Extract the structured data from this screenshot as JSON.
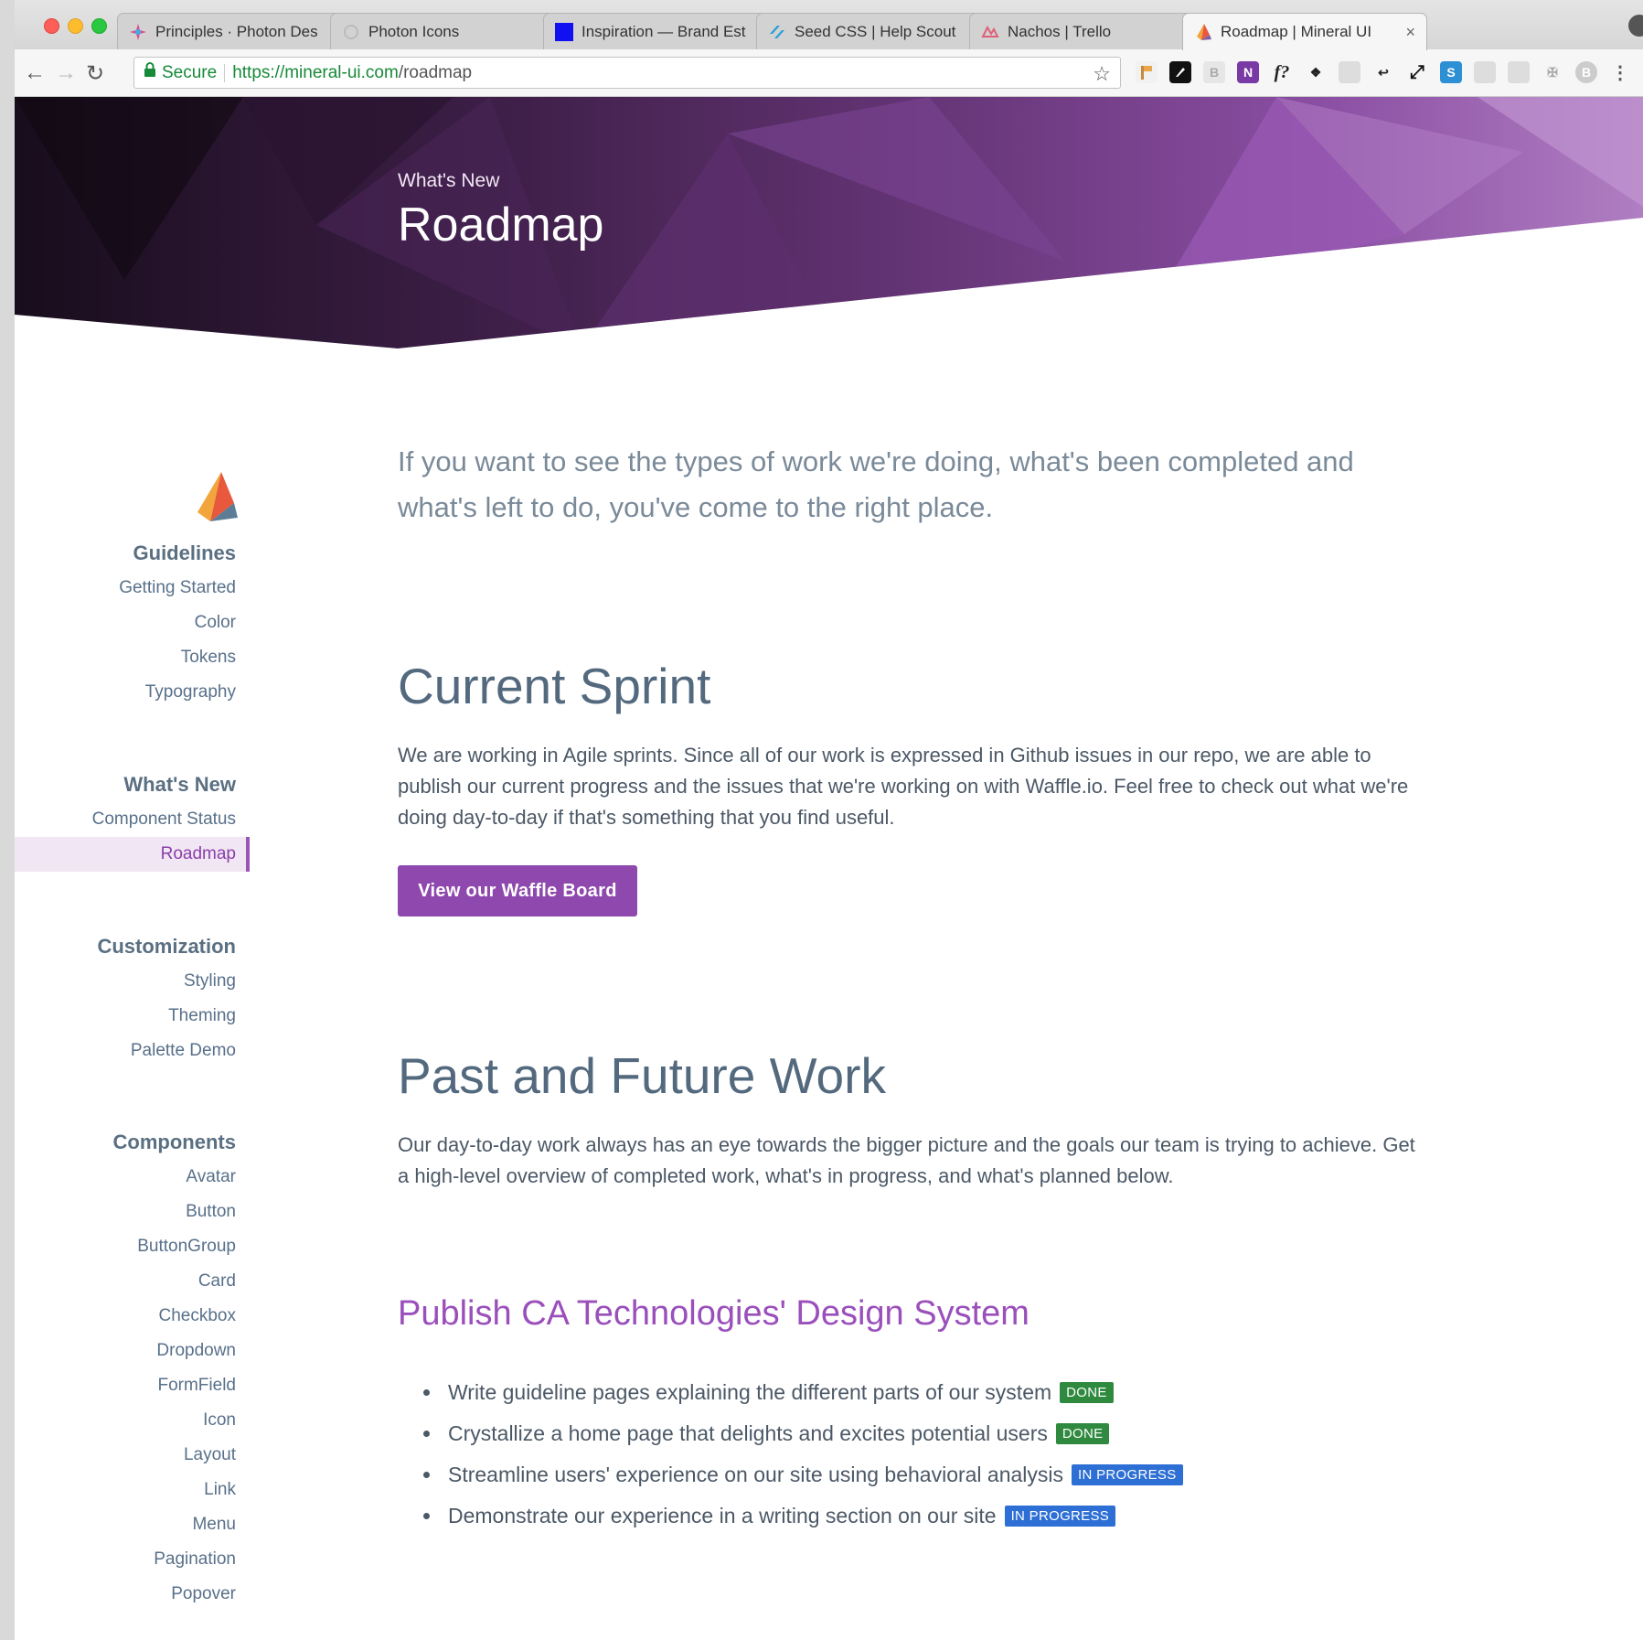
{
  "browser": {
    "tabs": [
      {
        "label": "Principles · Photon Des",
        "favicon": "photon-spark-icon"
      },
      {
        "label": "Photon Icons",
        "favicon": "loading-spinner-icon"
      },
      {
        "label": "Inspiration — Brand Est",
        "favicon": "blue-square-icon"
      },
      {
        "label": "Seed CSS | Help Scout",
        "favicon": "help-scout-icon"
      },
      {
        "label": "Nachos | Trello",
        "favicon": "nachos-icon"
      },
      {
        "label": "Roadmap | Mineral UI",
        "favicon": "mineral-ui-icon",
        "active": true
      }
    ],
    "tab_close_glyph": "×",
    "address_bar": {
      "secure_label": "Secure",
      "url_host": "https://mineral-ui.com",
      "url_path": "/roadmap"
    }
  },
  "hero": {
    "eyebrow": "What's New",
    "title": "Roadmap"
  },
  "sidebar": {
    "groups": [
      {
        "heading": "Guidelines",
        "links": [
          "Getting Started",
          "Color",
          "Tokens",
          "Typography"
        ]
      },
      {
        "heading": "What's New",
        "links": [
          "Component Status",
          "Roadmap"
        ],
        "active_link": "Roadmap"
      },
      {
        "heading": "Customization",
        "links": [
          "Styling",
          "Theming",
          "Palette Demo"
        ]
      },
      {
        "heading": "Components",
        "links": [
          "Avatar",
          "Button",
          "ButtonGroup",
          "Card",
          "Checkbox",
          "Dropdown",
          "FormField",
          "Icon",
          "Layout",
          "Link",
          "Menu",
          "Pagination",
          "Popover"
        ]
      }
    ]
  },
  "main": {
    "lead": "If you want to see the types of work we're doing, what's been completed and what's left to do, you've come to the right place.",
    "current_sprint": {
      "heading": "Current Sprint",
      "body": "We are working in Agile sprints. Since all of our work is expressed in Github issues in our repo, we are able to publish our current progress and the issues that we're working on with Waffle.io. Feel free to check out what we're doing day-to-day if that's something that you find useful.",
      "button_label": "View our Waffle Board"
    },
    "past_future": {
      "heading": "Past and Future Work",
      "body": "Our day-to-day work always has an eye towards the bigger picture and the goals our team is trying to achieve. Get a high-level overview of completed work, what's in progress, and what's planned below."
    },
    "goal": {
      "heading": "Publish CA Technologies' Design System",
      "tasks": [
        {
          "text": "Write guideline pages explaining the different parts of our system",
          "status": "DONE"
        },
        {
          "text": "Crystallize a home page that delights and excites potential users",
          "status": "DONE"
        },
        {
          "text": "Streamline users' experience on our site using behavioral analysis",
          "status": "IN PROGRESS"
        },
        {
          "text": "Demonstrate our experience in a writing section on our site",
          "status": "IN PROGRESS"
        }
      ]
    }
  },
  "colors": {
    "brand": "#8f48ad",
    "done": "#2f8a40",
    "in_progress": "#2d6fd4",
    "heading": "#53697e"
  }
}
